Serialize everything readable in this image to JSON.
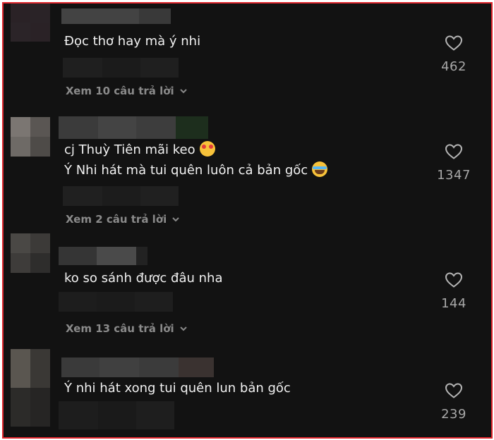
{
  "comments": [
    {
      "lines": [
        "Đọc thơ hay mà ý nhi"
      ],
      "likes": "462",
      "replies_label": "Xem 10 câu trả lời"
    },
    {
      "lines": [
        "cj Thuỳ Tiên mãi keo",
        "Ý Nhi hát mà tui quên luôn cả bản gốc"
      ],
      "line_emojis": [
        "smiling-face-with-hearts",
        "face-with-tears-of-joy"
      ],
      "likes": "1347",
      "replies_label": "Xem 2 câu trả lời"
    },
    {
      "lines": [
        "ko so sánh được đâu nha"
      ],
      "likes": "144",
      "replies_label": "Xem 13 câu trả lời"
    },
    {
      "lines": [
        "Ý nhi hát xong tui quên lun bản gốc"
      ],
      "likes": "239"
    }
  ],
  "colors": {
    "background": "#121212",
    "text": "#f1f1f1",
    "muted": "#8a8a8a",
    "frame": "#e0282e"
  }
}
